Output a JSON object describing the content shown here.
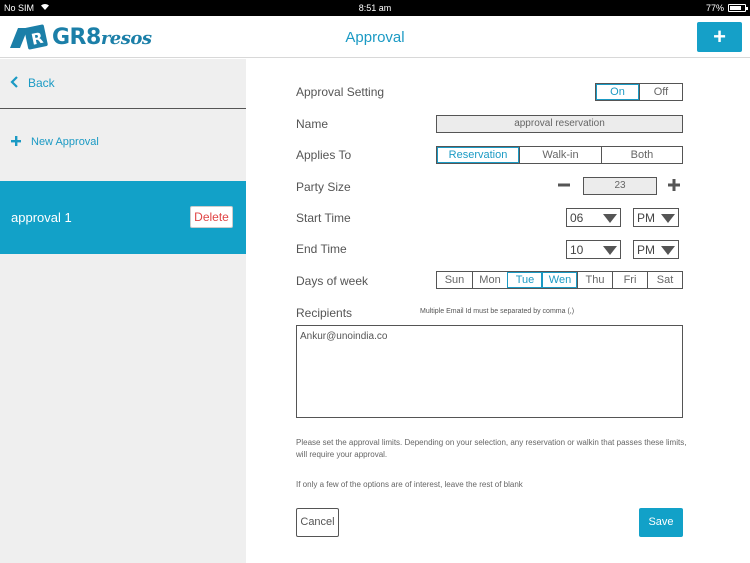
{
  "status_bar": {
    "carrier": "No SIM",
    "time": "8:51 am",
    "battery": "77%"
  },
  "nav": {
    "logo_main": "GR8",
    "logo_sub": "resos",
    "title": "Approval",
    "add_label": "+"
  },
  "sidebar": {
    "back_label": "Back",
    "new_approval_label": "New Approval",
    "items": [
      {
        "label": "approval 1",
        "delete_label": "Delete"
      }
    ]
  },
  "form": {
    "approval_setting": {
      "label": "Approval Setting",
      "options": [
        "On",
        "Off"
      ],
      "selected": "On"
    },
    "name": {
      "label": "Name",
      "value": "approval reservation"
    },
    "applies_to": {
      "label": "Applies To",
      "options": [
        "Reservation",
        "Walk-in",
        "Both"
      ],
      "selected": "Reservation"
    },
    "party_size": {
      "label": "Party Size",
      "value": "23",
      "minus": "−",
      "plus": "+"
    },
    "start_time": {
      "label": "Start Time",
      "hour": "06",
      "period": "PM"
    },
    "end_time": {
      "label": "End Time",
      "hour": "10",
      "period": "PM"
    },
    "days_of_week": {
      "label": "Days of week",
      "days": [
        "Sun",
        "Mon",
        "Tue",
        "Wen",
        "Thu",
        "Fri",
        "Sat"
      ],
      "selected": [
        "Tue",
        "Wen"
      ]
    },
    "recipients": {
      "label": "Recipients",
      "hint": "Multiple Email Id must be separated by comma (,)",
      "value": "Ankur@unoindia.co"
    },
    "note_1": "Please set the approval limits. Depending on your selection, any reservation or walkin that passes these limits, will require your approval.",
    "note_2": "If only a few of the options are of interest, leave the rest of blank",
    "cancel_label": "Cancel",
    "save_label": "Save"
  },
  "colors": {
    "accent": "#12a1c8",
    "delete": "#e04545"
  }
}
